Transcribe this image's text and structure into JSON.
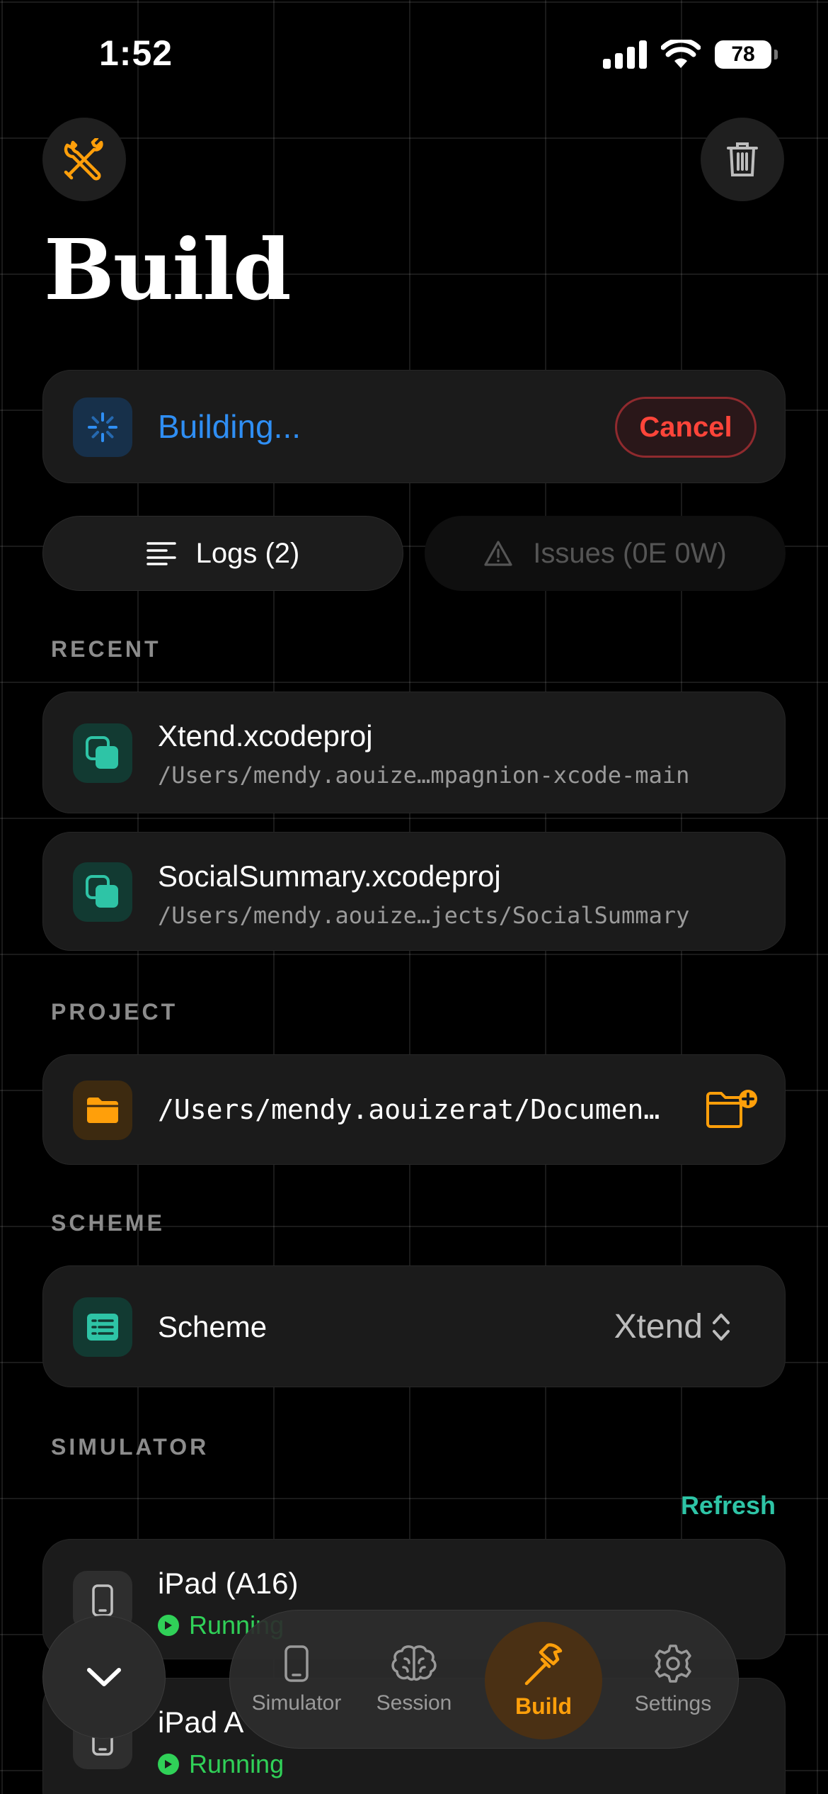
{
  "status_bar": {
    "time": "1:52",
    "battery": "78"
  },
  "header": {
    "title": "Build"
  },
  "build": {
    "status": "Building...",
    "cancel_label": "Cancel"
  },
  "tabs": {
    "logs": "Logs (2)",
    "issues": "Issues (0E 0W)"
  },
  "recent": {
    "label": "RECENT",
    "items": [
      {
        "name": "Xtend.xcodeproj",
        "path": "/Users/mendy.aouize…mpagnion-xcode-main"
      },
      {
        "name": "SocialSummary.xcodeproj",
        "path": "/Users/mendy.aouize…jects/SocialSummary"
      }
    ]
  },
  "project": {
    "label": "PROJECT",
    "path": "/Users/mendy.aouizerat/Documen…"
  },
  "scheme": {
    "label": "SCHEME",
    "title": "Scheme",
    "value": "Xtend"
  },
  "simulator": {
    "label": "SIMULATOR",
    "refresh_label": "Refresh",
    "devices": [
      {
        "name": "iPad (A16)",
        "status": "Running"
      },
      {
        "name": "iPad A",
        "status": "Running"
      }
    ]
  },
  "tab_bar": {
    "items": [
      {
        "label": "Simulator",
        "icon": "phone-icon"
      },
      {
        "label": "Session",
        "icon": "brain-icon"
      },
      {
        "label": "Build",
        "icon": "hammer-icon"
      },
      {
        "label": "Settings",
        "icon": "gear-icon"
      }
    ],
    "active": "Build"
  },
  "colors": {
    "accent_orange": "#ff9f0a",
    "building_blue": "#2f8ef3",
    "cancel_red": "#ff453a",
    "teal": "#2ec4a6",
    "running_green": "#30d158"
  }
}
